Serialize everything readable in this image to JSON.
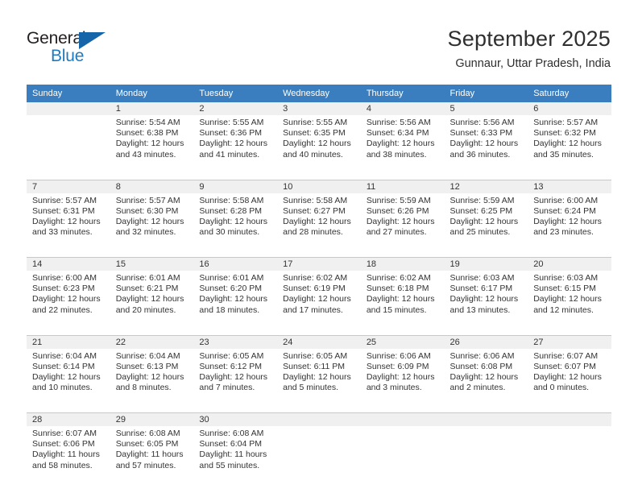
{
  "brand": {
    "name_part1": "General",
    "name_part2": "Blue",
    "triangle_icon": "triangle-icon",
    "colors": {
      "dark": "#231f20",
      "blue": "#1f7bc1",
      "triangle": "#1565a8"
    }
  },
  "header": {
    "title": "September 2025",
    "subtitle": "Gunnaur, Uttar Pradesh, India"
  },
  "theme": {
    "header_row_bg": "#3a7ebf",
    "header_row_text": "#ffffff",
    "daynum_bg": "#f0f0f0",
    "grid_line": "#c8c8c8",
    "body_text": "#333333"
  },
  "weekday_headers": [
    "Sunday",
    "Monday",
    "Tuesday",
    "Wednesday",
    "Thursday",
    "Friday",
    "Saturday"
  ],
  "labels": {
    "sunrise_prefix": "Sunrise: ",
    "sunset_prefix": "Sunset: ",
    "daylight_prefix": "Daylight: "
  },
  "weeks": [
    [
      {
        "empty": true
      },
      {
        "day": "1",
        "sunrise": "Sunrise: 5:54 AM",
        "sunset": "Sunset: 6:38 PM",
        "daylight_line1": "Daylight: 12 hours",
        "daylight_line2": "and 43 minutes."
      },
      {
        "day": "2",
        "sunrise": "Sunrise: 5:55 AM",
        "sunset": "Sunset: 6:36 PM",
        "daylight_line1": "Daylight: 12 hours",
        "daylight_line2": "and 41 minutes."
      },
      {
        "day": "3",
        "sunrise": "Sunrise: 5:55 AM",
        "sunset": "Sunset: 6:35 PM",
        "daylight_line1": "Daylight: 12 hours",
        "daylight_line2": "and 40 minutes."
      },
      {
        "day": "4",
        "sunrise": "Sunrise: 5:56 AM",
        "sunset": "Sunset: 6:34 PM",
        "daylight_line1": "Daylight: 12 hours",
        "daylight_line2": "and 38 minutes."
      },
      {
        "day": "5",
        "sunrise": "Sunrise: 5:56 AM",
        "sunset": "Sunset: 6:33 PM",
        "daylight_line1": "Daylight: 12 hours",
        "daylight_line2": "and 36 minutes."
      },
      {
        "day": "6",
        "sunrise": "Sunrise: 5:57 AM",
        "sunset": "Sunset: 6:32 PM",
        "daylight_line1": "Daylight: 12 hours",
        "daylight_line2": "and 35 minutes."
      }
    ],
    [
      {
        "day": "7",
        "sunrise": "Sunrise: 5:57 AM",
        "sunset": "Sunset: 6:31 PM",
        "daylight_line1": "Daylight: 12 hours",
        "daylight_line2": "and 33 minutes."
      },
      {
        "day": "8",
        "sunrise": "Sunrise: 5:57 AM",
        "sunset": "Sunset: 6:30 PM",
        "daylight_line1": "Daylight: 12 hours",
        "daylight_line2": "and 32 minutes."
      },
      {
        "day": "9",
        "sunrise": "Sunrise: 5:58 AM",
        "sunset": "Sunset: 6:28 PM",
        "daylight_line1": "Daylight: 12 hours",
        "daylight_line2": "and 30 minutes."
      },
      {
        "day": "10",
        "sunrise": "Sunrise: 5:58 AM",
        "sunset": "Sunset: 6:27 PM",
        "daylight_line1": "Daylight: 12 hours",
        "daylight_line2": "and 28 minutes."
      },
      {
        "day": "11",
        "sunrise": "Sunrise: 5:59 AM",
        "sunset": "Sunset: 6:26 PM",
        "daylight_line1": "Daylight: 12 hours",
        "daylight_line2": "and 27 minutes."
      },
      {
        "day": "12",
        "sunrise": "Sunrise: 5:59 AM",
        "sunset": "Sunset: 6:25 PM",
        "daylight_line1": "Daylight: 12 hours",
        "daylight_line2": "and 25 minutes."
      },
      {
        "day": "13",
        "sunrise": "Sunrise: 6:00 AM",
        "sunset": "Sunset: 6:24 PM",
        "daylight_line1": "Daylight: 12 hours",
        "daylight_line2": "and 23 minutes."
      }
    ],
    [
      {
        "day": "14",
        "sunrise": "Sunrise: 6:00 AM",
        "sunset": "Sunset: 6:23 PM",
        "daylight_line1": "Daylight: 12 hours",
        "daylight_line2": "and 22 minutes."
      },
      {
        "day": "15",
        "sunrise": "Sunrise: 6:01 AM",
        "sunset": "Sunset: 6:21 PM",
        "daylight_line1": "Daylight: 12 hours",
        "daylight_line2": "and 20 minutes."
      },
      {
        "day": "16",
        "sunrise": "Sunrise: 6:01 AM",
        "sunset": "Sunset: 6:20 PM",
        "daylight_line1": "Daylight: 12 hours",
        "daylight_line2": "and 18 minutes."
      },
      {
        "day": "17",
        "sunrise": "Sunrise: 6:02 AM",
        "sunset": "Sunset: 6:19 PM",
        "daylight_line1": "Daylight: 12 hours",
        "daylight_line2": "and 17 minutes."
      },
      {
        "day": "18",
        "sunrise": "Sunrise: 6:02 AM",
        "sunset": "Sunset: 6:18 PM",
        "daylight_line1": "Daylight: 12 hours",
        "daylight_line2": "and 15 minutes."
      },
      {
        "day": "19",
        "sunrise": "Sunrise: 6:03 AM",
        "sunset": "Sunset: 6:17 PM",
        "daylight_line1": "Daylight: 12 hours",
        "daylight_line2": "and 13 minutes."
      },
      {
        "day": "20",
        "sunrise": "Sunrise: 6:03 AM",
        "sunset": "Sunset: 6:15 PM",
        "daylight_line1": "Daylight: 12 hours",
        "daylight_line2": "and 12 minutes."
      }
    ],
    [
      {
        "day": "21",
        "sunrise": "Sunrise: 6:04 AM",
        "sunset": "Sunset: 6:14 PM",
        "daylight_line1": "Daylight: 12 hours",
        "daylight_line2": "and 10 minutes."
      },
      {
        "day": "22",
        "sunrise": "Sunrise: 6:04 AM",
        "sunset": "Sunset: 6:13 PM",
        "daylight_line1": "Daylight: 12 hours",
        "daylight_line2": "and 8 minutes."
      },
      {
        "day": "23",
        "sunrise": "Sunrise: 6:05 AM",
        "sunset": "Sunset: 6:12 PM",
        "daylight_line1": "Daylight: 12 hours",
        "daylight_line2": "and 7 minutes."
      },
      {
        "day": "24",
        "sunrise": "Sunrise: 6:05 AM",
        "sunset": "Sunset: 6:11 PM",
        "daylight_line1": "Daylight: 12 hours",
        "daylight_line2": "and 5 minutes."
      },
      {
        "day": "25",
        "sunrise": "Sunrise: 6:06 AM",
        "sunset": "Sunset: 6:09 PM",
        "daylight_line1": "Daylight: 12 hours",
        "daylight_line2": "and 3 minutes."
      },
      {
        "day": "26",
        "sunrise": "Sunrise: 6:06 AM",
        "sunset": "Sunset: 6:08 PM",
        "daylight_line1": "Daylight: 12 hours",
        "daylight_line2": "and 2 minutes."
      },
      {
        "day": "27",
        "sunrise": "Sunrise: 6:07 AM",
        "sunset": "Sunset: 6:07 PM",
        "daylight_line1": "Daylight: 12 hours",
        "daylight_line2": "and 0 minutes."
      }
    ],
    [
      {
        "day": "28",
        "sunrise": "Sunrise: 6:07 AM",
        "sunset": "Sunset: 6:06 PM",
        "daylight_line1": "Daylight: 11 hours",
        "daylight_line2": "and 58 minutes."
      },
      {
        "day": "29",
        "sunrise": "Sunrise: 6:08 AM",
        "sunset": "Sunset: 6:05 PM",
        "daylight_line1": "Daylight: 11 hours",
        "daylight_line2": "and 57 minutes."
      },
      {
        "day": "30",
        "sunrise": "Sunrise: 6:08 AM",
        "sunset": "Sunset: 6:04 PM",
        "daylight_line1": "Daylight: 11 hours",
        "daylight_line2": "and 55 minutes."
      },
      {
        "empty": true
      },
      {
        "empty": true
      },
      {
        "empty": true
      },
      {
        "empty": true
      }
    ]
  ]
}
